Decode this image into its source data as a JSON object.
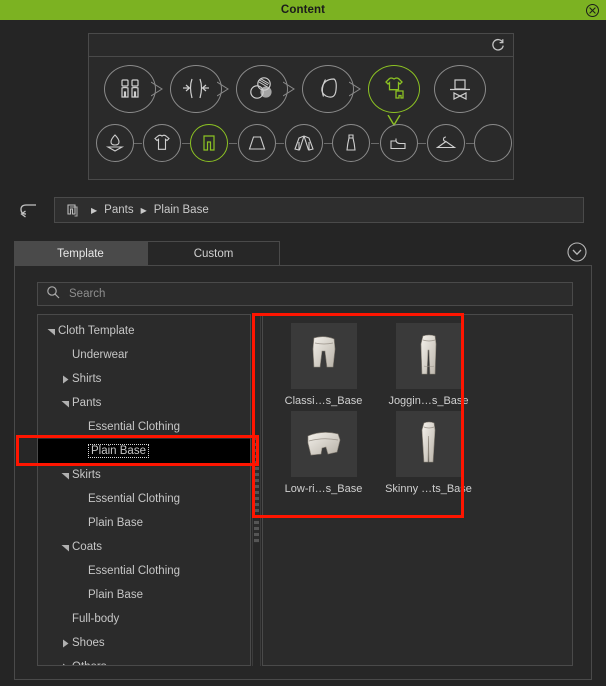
{
  "window": {
    "title": "Content",
    "close_icon": "close-circle-icon",
    "accent_color": "#7cb222",
    "background_color": "#252525"
  },
  "navigator": {
    "refresh_icon": "refresh-icon",
    "stage_row": [
      {
        "id": "avatar",
        "icon": "avatar-body-icon",
        "active": false
      },
      {
        "id": "shape",
        "icon": "body-shape-icon",
        "active": false
      },
      {
        "id": "skin",
        "icon": "skin-texture-icon",
        "active": false
      },
      {
        "id": "head",
        "icon": "head-profile-icon",
        "active": false
      },
      {
        "id": "cloth",
        "icon": "clothing-icon",
        "active": true
      },
      {
        "id": "accessory",
        "icon": "hat-accessory-icon",
        "active": false
      }
    ],
    "category_row": [
      {
        "id": "underwear",
        "icon": "underwear-icon",
        "active": false
      },
      {
        "id": "shirts",
        "icon": "tshirt-icon",
        "active": false
      },
      {
        "id": "pants",
        "icon": "pants-icon",
        "active": true
      },
      {
        "id": "skirts",
        "icon": "skirt-icon",
        "active": false
      },
      {
        "id": "coats",
        "icon": "coat-icon",
        "active": false
      },
      {
        "id": "fullbody",
        "icon": "dress-icon",
        "active": false
      },
      {
        "id": "shoes",
        "icon": "shoe-icon",
        "active": false
      },
      {
        "id": "others",
        "icon": "hanger-icon",
        "active": false
      },
      {
        "id": "empty",
        "icon": "empty-icon",
        "active": false
      }
    ]
  },
  "breadcrumb": {
    "back_icon": "undo-arrow-icon",
    "root_icon": "pants-small-icon",
    "separator": "▶",
    "items": [
      "Pants",
      "Plain Base"
    ]
  },
  "tabs": [
    {
      "label": "Template",
      "active": true
    },
    {
      "label": "Custom",
      "active": false
    }
  ],
  "collapse_icon": "chevron-down-circle-icon",
  "search": {
    "icon": "search-icon",
    "value": "",
    "placeholder": "Search"
  },
  "tree": {
    "items": [
      {
        "label": "Cloth Template",
        "level": 0,
        "twisty": "expanded",
        "selected": false
      },
      {
        "label": "Underwear",
        "level": 1,
        "twisty": "none",
        "selected": false
      },
      {
        "label": "Shirts",
        "level": 1,
        "twisty": "collapsed",
        "selected": false
      },
      {
        "label": "Pants",
        "level": 1,
        "twisty": "expanded",
        "selected": false
      },
      {
        "label": "Essential Clothing",
        "level": 2,
        "twisty": "none",
        "selected": false
      },
      {
        "label": "Plain Base",
        "level": 2,
        "twisty": "none",
        "selected": true
      },
      {
        "label": "Skirts",
        "level": 1,
        "twisty": "expanded",
        "selected": false
      },
      {
        "label": "Essential Clothing",
        "level": 2,
        "twisty": "none",
        "selected": false
      },
      {
        "label": "Plain Base",
        "level": 2,
        "twisty": "none",
        "selected": false
      },
      {
        "label": "Coats",
        "level": 1,
        "twisty": "expanded",
        "selected": false
      },
      {
        "label": "Essential Clothing",
        "level": 2,
        "twisty": "none",
        "selected": false
      },
      {
        "label": "Plain Base",
        "level": 2,
        "twisty": "none",
        "selected": false
      },
      {
        "label": "Full-body",
        "level": 1,
        "twisty": "none",
        "selected": false
      },
      {
        "label": "Shoes",
        "level": 1,
        "twisty": "collapsed",
        "selected": false
      },
      {
        "label": "Others",
        "level": 1,
        "twisty": "collapsed",
        "selected": false
      }
    ]
  },
  "thumbnails": [
    {
      "label": "Classi…s_Base",
      "icon": "classic-shorts-thumb"
    },
    {
      "label": "Joggin…s_Base",
      "icon": "jogging-pants-thumb"
    },
    {
      "label": "Low-ri…s_Base",
      "icon": "low-rise-shorts-thumb"
    },
    {
      "label": "Skinny …ts_Base",
      "icon": "skinny-pants-thumb"
    }
  ],
  "annotations": {
    "color": "#ff1500",
    "regions": [
      "selected-tree-item-highlight",
      "thumbnail-grid-highlight"
    ]
  }
}
